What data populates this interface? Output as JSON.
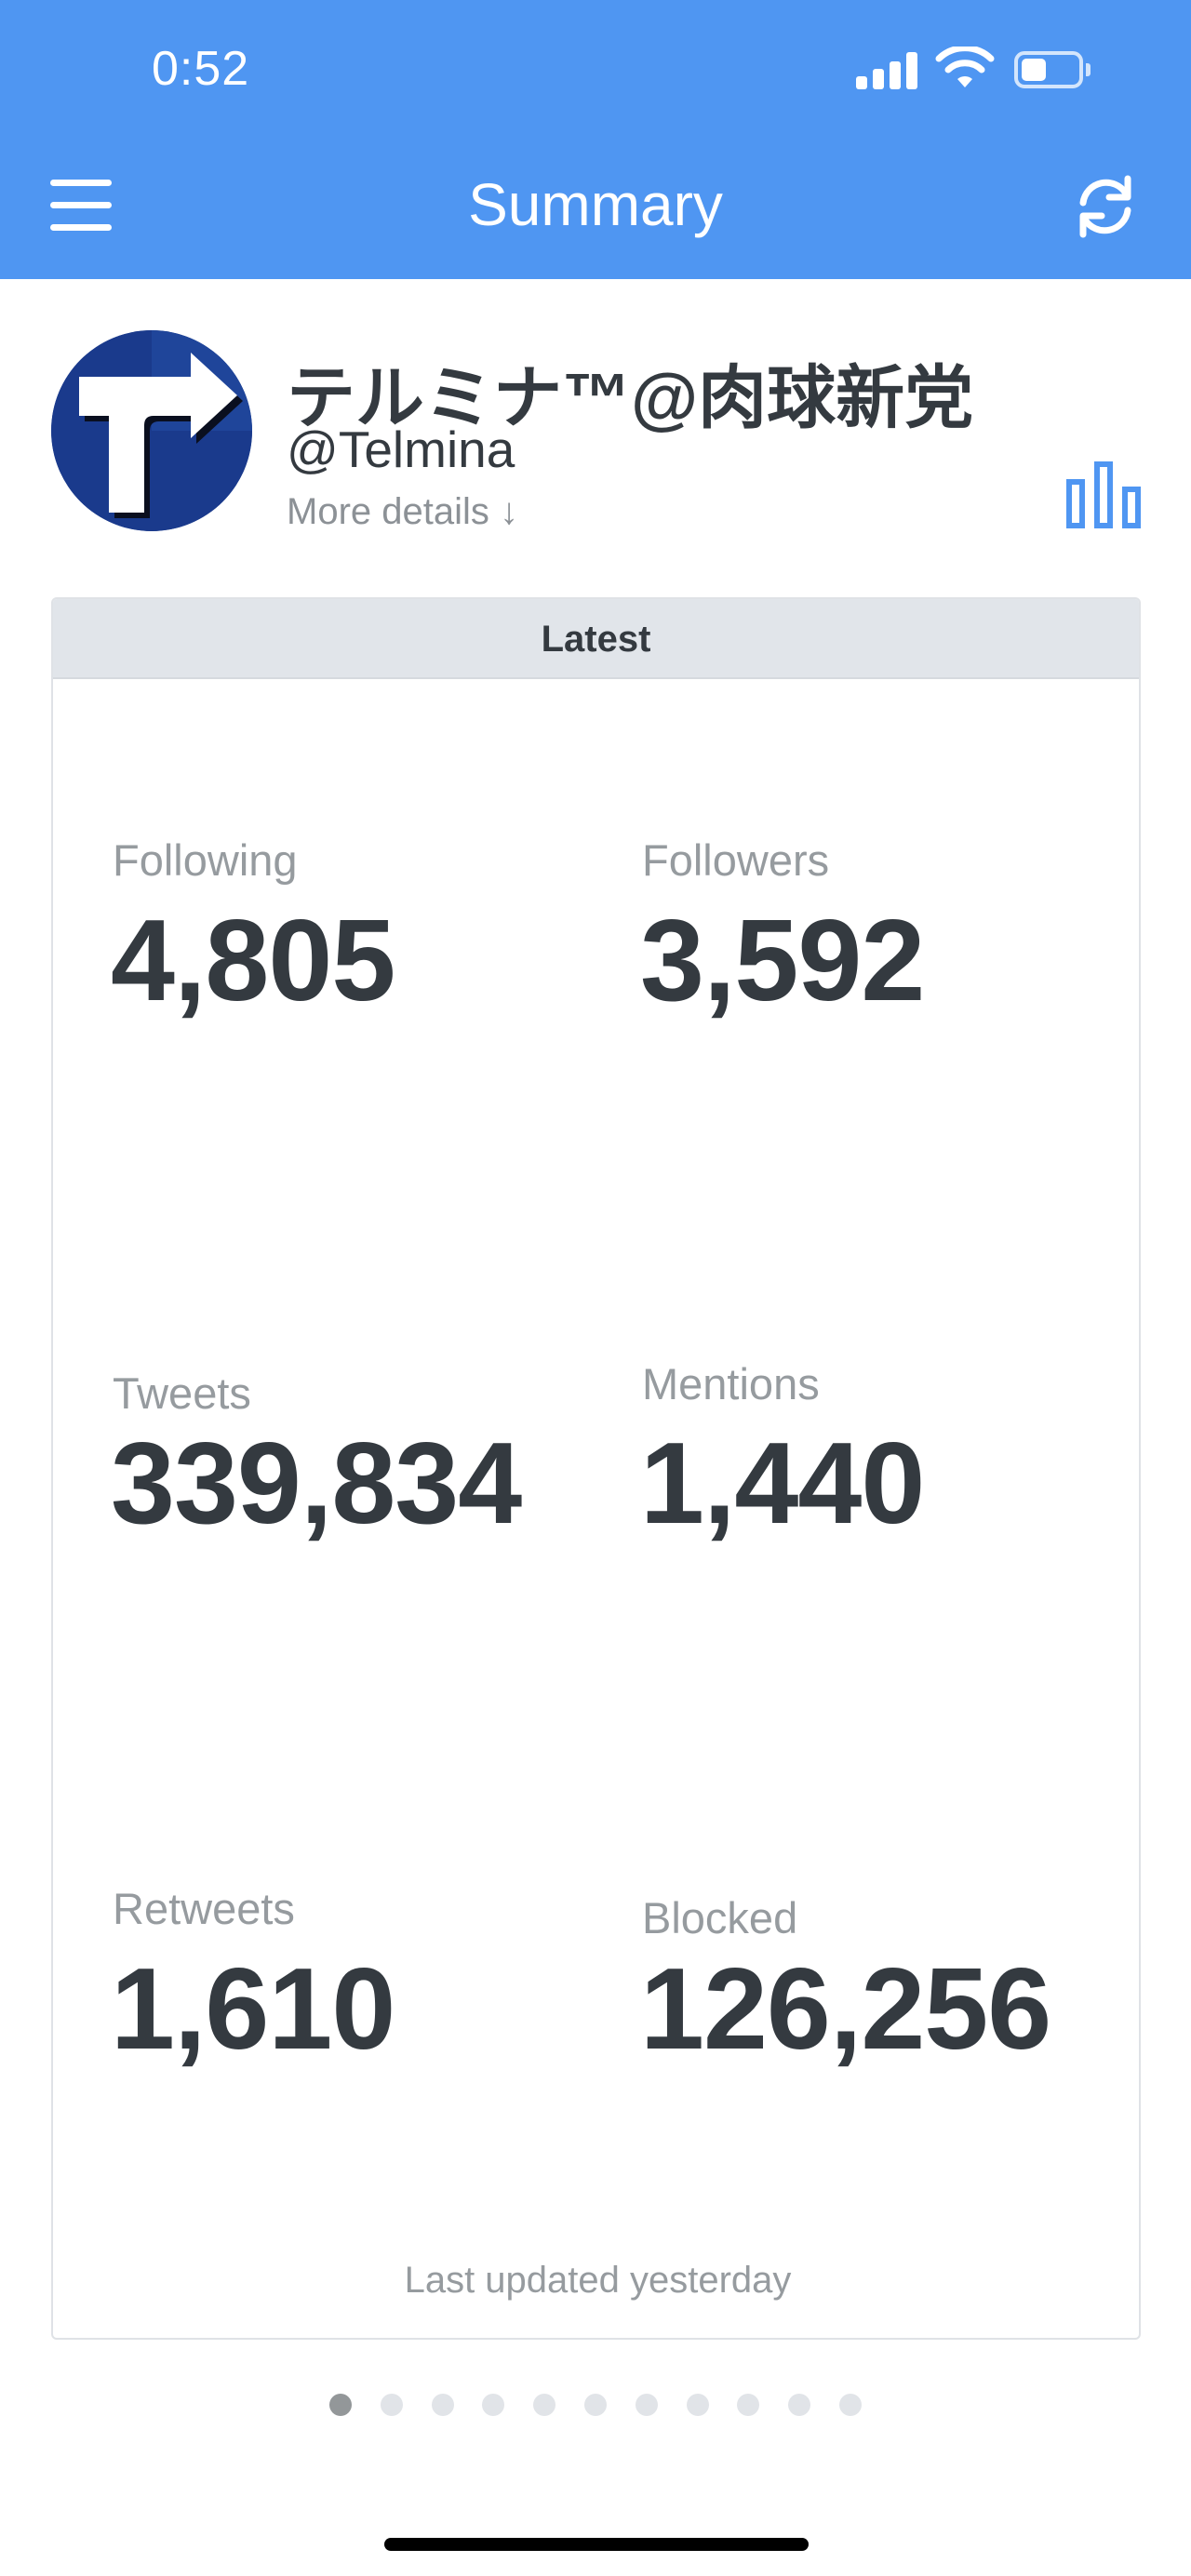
{
  "status_bar": {
    "time": "0:52",
    "battery_level": 0.45
  },
  "nav": {
    "title": "Summary",
    "menu_icon": "hamburger-menu-icon",
    "refresh_icon": "refresh-icon"
  },
  "profile": {
    "name": "テルミナ™@肉球新党",
    "handle": "@Telmina",
    "more_details": "More details ↓",
    "stats_icon": "bar-chart-icon"
  },
  "card": {
    "header": "Latest",
    "stats": [
      {
        "label": "Following",
        "value": "4,805"
      },
      {
        "label": "Followers",
        "value": "3,592"
      },
      {
        "label": "Tweets",
        "value": "339,834"
      },
      {
        "label": "Mentions",
        "value": "1,440"
      },
      {
        "label": "Retweets",
        "value": "1,610"
      },
      {
        "label": "Blocked",
        "value": "126,256"
      }
    ],
    "footer": "Last updated yesterday"
  },
  "pager": {
    "total": 11,
    "active": 1
  },
  "colors": {
    "accent": "#4f96f2",
    "text": "#343a40",
    "muted": "#969b9f"
  }
}
